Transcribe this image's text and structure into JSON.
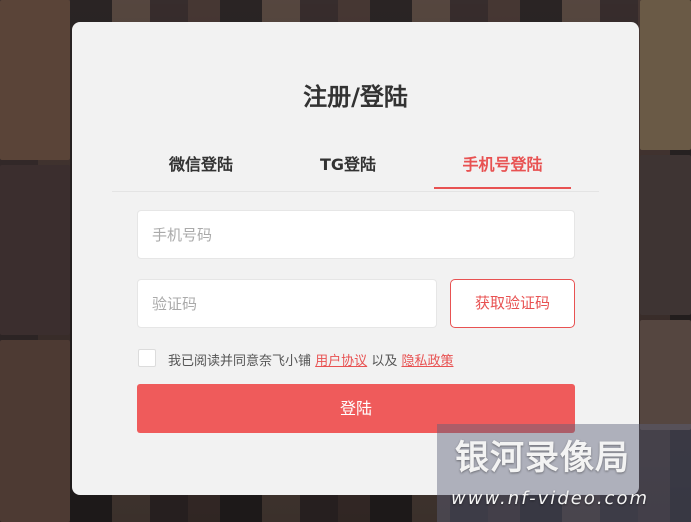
{
  "modal": {
    "title": "注册/登陆",
    "tabs": [
      {
        "label": "微信登陆",
        "active": false
      },
      {
        "label": "TG登陆",
        "active": false
      },
      {
        "label": "手机号登陆",
        "active": true
      }
    ],
    "phone_placeholder": "手机号码",
    "code_placeholder": "验证码",
    "get_code_label": "获取验证码",
    "agree": {
      "text": "我已阅读并同意奈飞小铺",
      "user_agreement": "用户协议",
      "and": "以及",
      "privacy_policy": "隐私政策",
      "checked": false
    },
    "login_label": "登陆"
  },
  "watermark": {
    "title": "银河录像局",
    "url": "www.nf-video.com"
  },
  "colors": {
    "accent": "#e85252",
    "button": "#ef5b5b",
    "modal_bg": "#f2f2f2"
  }
}
